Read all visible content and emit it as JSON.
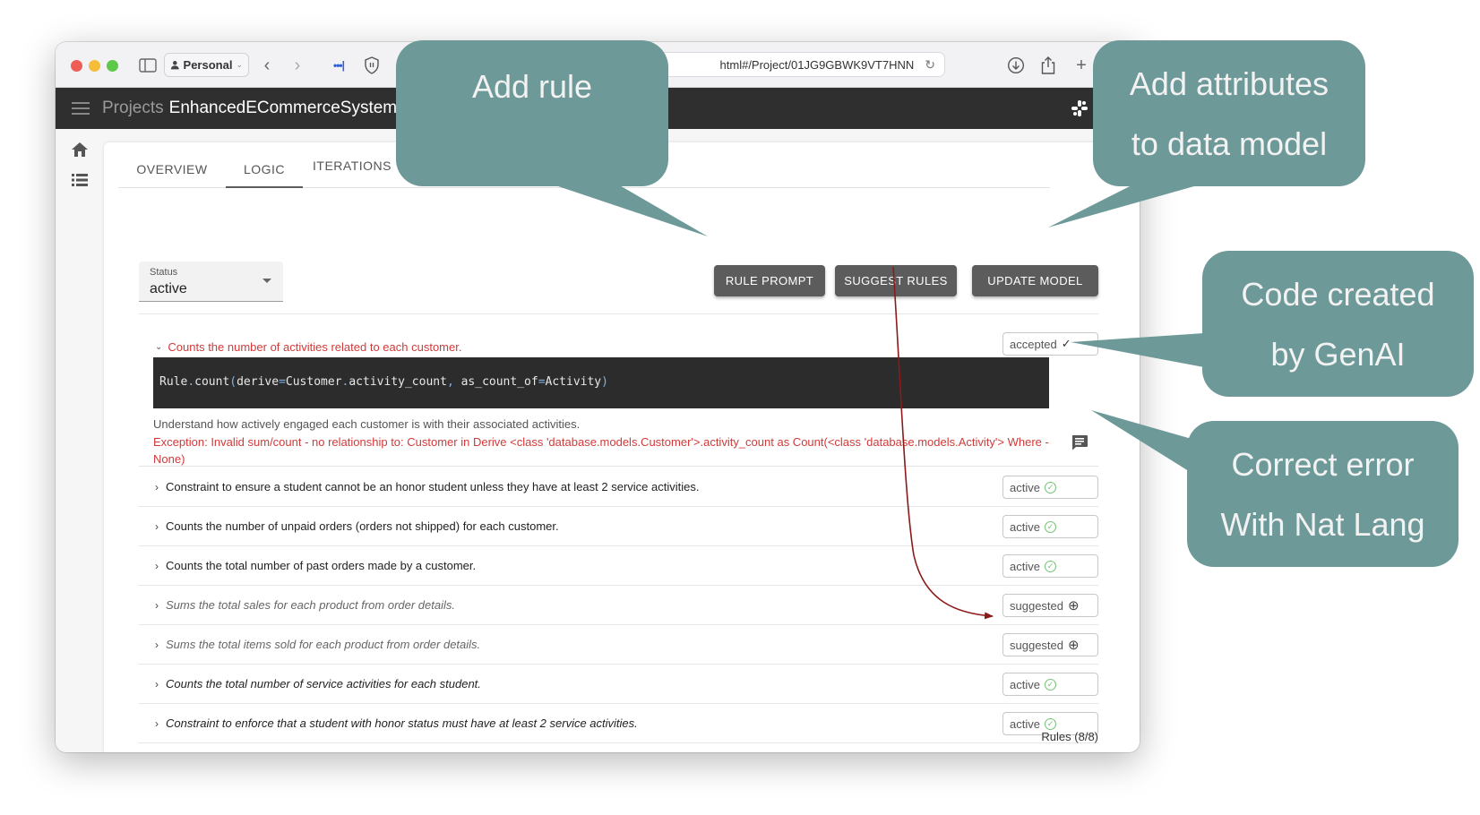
{
  "browser": {
    "profile_label": "Personal",
    "url": "html#/Project/01JG9GBWK9VT7HNN"
  },
  "appbar": {
    "breadcrumb": "Projects",
    "project_name": "EnhancedECommerceSystem"
  },
  "tabs": [
    {
      "label": "OVERVIEW",
      "active": false
    },
    {
      "label": "LOGIC",
      "active": true
    },
    {
      "label": "ITERATIONS",
      "active": false
    }
  ],
  "status_filter": {
    "label": "Status",
    "value": "active"
  },
  "actions": {
    "rule_prompt": "RULE PROMPT",
    "suggest_rules": "SUGGEST RULES",
    "update_model": "UPDATE MODEL"
  },
  "expanded_rule": {
    "title": "Counts the number of activities related to each customer.",
    "code": {
      "prefix": "Rule",
      "dot1": ".",
      "fn": "count",
      "open": "(",
      "arg1": "derive",
      "eq1": "=",
      "val1a": "Customer",
      "dot2": ".",
      "val1b": "activity_count",
      "comma": ",",
      "arg2": " as_count_of",
      "eq2": "=",
      "val2": "Activity",
      "close": ")"
    },
    "description": "Understand how actively engaged each customer is with their associated activities.",
    "error": "Exception: Invalid sum/count - no relationship to: Customer in Derive <class 'database.models.Customer'>.activity_count as Count(<class 'database.models.Activity'> Where - None)",
    "status": "accepted",
    "status_icon": "check-icon"
  },
  "rules": [
    {
      "text": "Constraint to ensure a student cannot be an honor student unless they have at least 2 service activities.",
      "status": "active",
      "style": "normal"
    },
    {
      "text": "Counts the number of unpaid orders (orders not shipped) for each customer.",
      "status": "active",
      "style": "normal"
    },
    {
      "text": "Counts the total number of past orders made by a customer.",
      "status": "active",
      "style": "normal"
    },
    {
      "text": "Sums the total sales for each product from order details.",
      "status": "suggested",
      "style": "italic-muted"
    },
    {
      "text": "Sums the total items sold for each product from order details.",
      "status": "suggested",
      "style": "italic-muted"
    },
    {
      "text": "Counts the total number of service activities for each student.",
      "status": "active",
      "style": "italic"
    },
    {
      "text": "Constraint to enforce that a student with honor status must have at least 2 service activities.",
      "status": "active",
      "style": "italic"
    }
  ],
  "footer": {
    "rules_count": "Rules (8/8)"
  },
  "callouts": {
    "add_rule": [
      "Add rule"
    ],
    "add_attributes": [
      "Add attributes",
      "to data model"
    ],
    "code_created": [
      "Code created",
      "by GenAI"
    ],
    "correct_error": [
      "Correct error",
      "With Nat Lang"
    ]
  },
  "colors": {
    "callout": "#6e9999",
    "appbar": "#2f2f2f",
    "button": "#5c5c5c",
    "error": "#d23a3a",
    "active_check": "#74c274",
    "arrow": "#8b1a1a"
  }
}
